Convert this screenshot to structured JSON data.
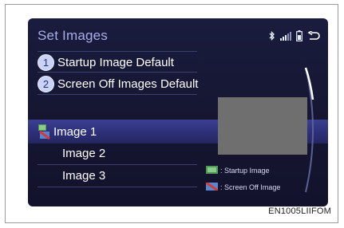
{
  "screen": {
    "title": "Set Images"
  },
  "menu": [
    {
      "number": "1",
      "label": "Startup Image Default"
    },
    {
      "number": "2",
      "label": "Screen Off Images Default"
    },
    {
      "label": "Image 1"
    },
    {
      "label": "Image 2"
    },
    {
      "label": "Image 3"
    }
  ],
  "legend": {
    "startup_label": ": Startup Image",
    "screen_off_label": ": Screen Off Image"
  },
  "status_icons": [
    "bluetooth-icon",
    "signal-bars-icon",
    "phone-battery-icon",
    "back-arrow-icon"
  ],
  "figure_code": "EN1005LIIFOM",
  "colors": {
    "screen_bg": "#161733",
    "title_text": "#a9aee8",
    "selected_bar": "#2c2f76",
    "badge_bg": "#c9d3f5",
    "preview_box": "#6f6f6f"
  }
}
